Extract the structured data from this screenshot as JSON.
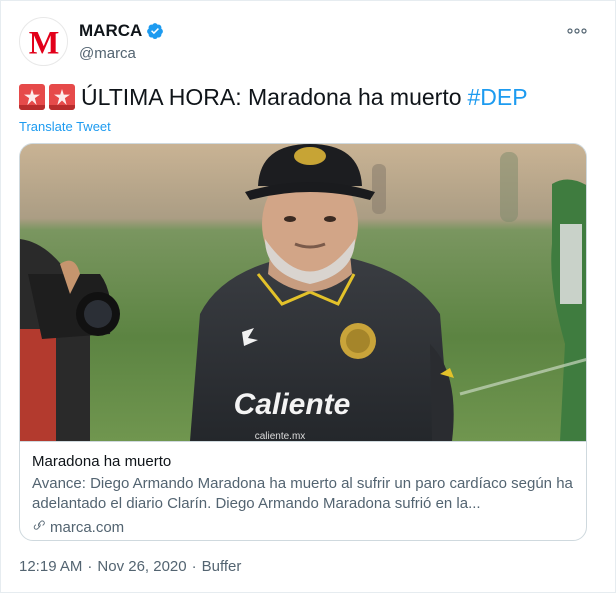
{
  "author": {
    "display_name": "MARCA",
    "handle": "@marca",
    "avatar_letter": "M",
    "verified": true
  },
  "tweet": {
    "text": "ÚLTIMA HORA: Maradona ha muerto",
    "hashtag": "#DEP",
    "translate_label": "Translate Tweet"
  },
  "card": {
    "title": "Maradona ha muerto",
    "description": "Avance: Diego Armando Maradona ha muerto al sufrir un paro cardíaco según ha adelantado el diario Clarín. Diego Armando Maradona sufrió en la...",
    "domain": "marca.com",
    "image_text": {
      "shirt_sponsor": "Caliente",
      "shirt_sub": "caliente.mx"
    }
  },
  "footer": {
    "time": "12:19 AM",
    "date": "Nov 26, 2020",
    "source": "Buffer",
    "separator": "·"
  },
  "colors": {
    "link": "#1d9bf0",
    "brand_red": "#e2001a",
    "verified_blue": "#1d9bf0",
    "muted": "#536471"
  },
  "icons": {
    "siren": "police-car-light-emoji",
    "more": "more-dots-icon",
    "link": "link-icon",
    "verified": "verified-badge-icon"
  }
}
